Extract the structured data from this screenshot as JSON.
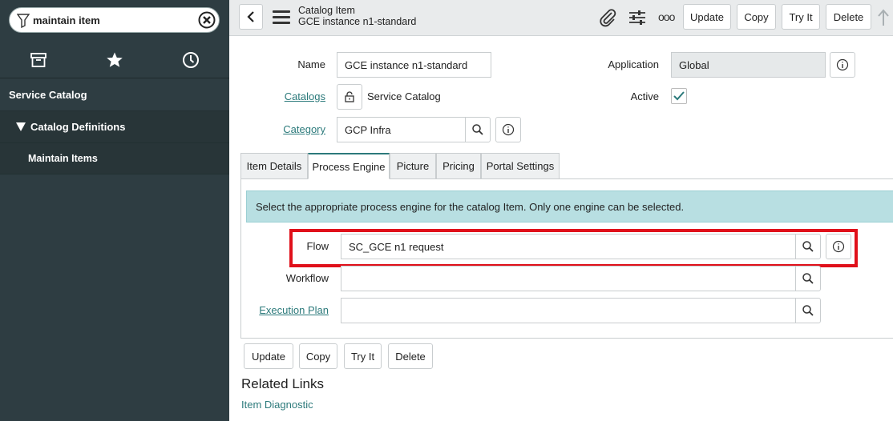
{
  "sidebar": {
    "filter_value": "maintain item",
    "tabs": [
      {
        "icon": "archive-icon"
      },
      {
        "icon": "star-icon"
      },
      {
        "icon": "clock-icon"
      }
    ],
    "application": "Service Catalog",
    "module": "Catalog Definitions",
    "item": "Maintain Items"
  },
  "header": {
    "title": "Catalog Item",
    "subtitle": "GCE instance n1-standard",
    "buttons": {
      "update": "Update",
      "copy": "Copy",
      "try_it": "Try It",
      "delete": "Delete"
    },
    "more": "ooo"
  },
  "form": {
    "name_label": "Name",
    "name_value": "GCE instance n1-standard",
    "application_label": "Application",
    "application_value": "Global",
    "catalogs_label": "Catalogs",
    "catalogs_value": "Service Catalog",
    "active_label": "Active",
    "category_label": "Category",
    "category_value": "GCP Infra"
  },
  "tabs": [
    "Item Details",
    "Process Engine",
    "Picture",
    "Pricing",
    "Portal Settings"
  ],
  "active_tab": "Process Engine",
  "process_engine": {
    "info": "Select the appropriate process engine for the catalog Item. Only one engine can be selected.",
    "flow_label": "Flow",
    "flow_value": "SC_GCE n1 request",
    "workflow_label": "Workflow",
    "workflow_value": "",
    "execution_plan_label": "Execution Plan",
    "execution_plan_value": ""
  },
  "footer_buttons": {
    "update": "Update",
    "copy": "Copy",
    "try_it": "Try It",
    "delete": "Delete"
  },
  "related": {
    "heading": "Related Links",
    "links": [
      "Item Diagnostic"
    ]
  },
  "colors": {
    "accent": "#2c7a7b",
    "sidebar": "#2e3d42",
    "highlight": "#e0101a",
    "banner": "#b8dfe2"
  }
}
